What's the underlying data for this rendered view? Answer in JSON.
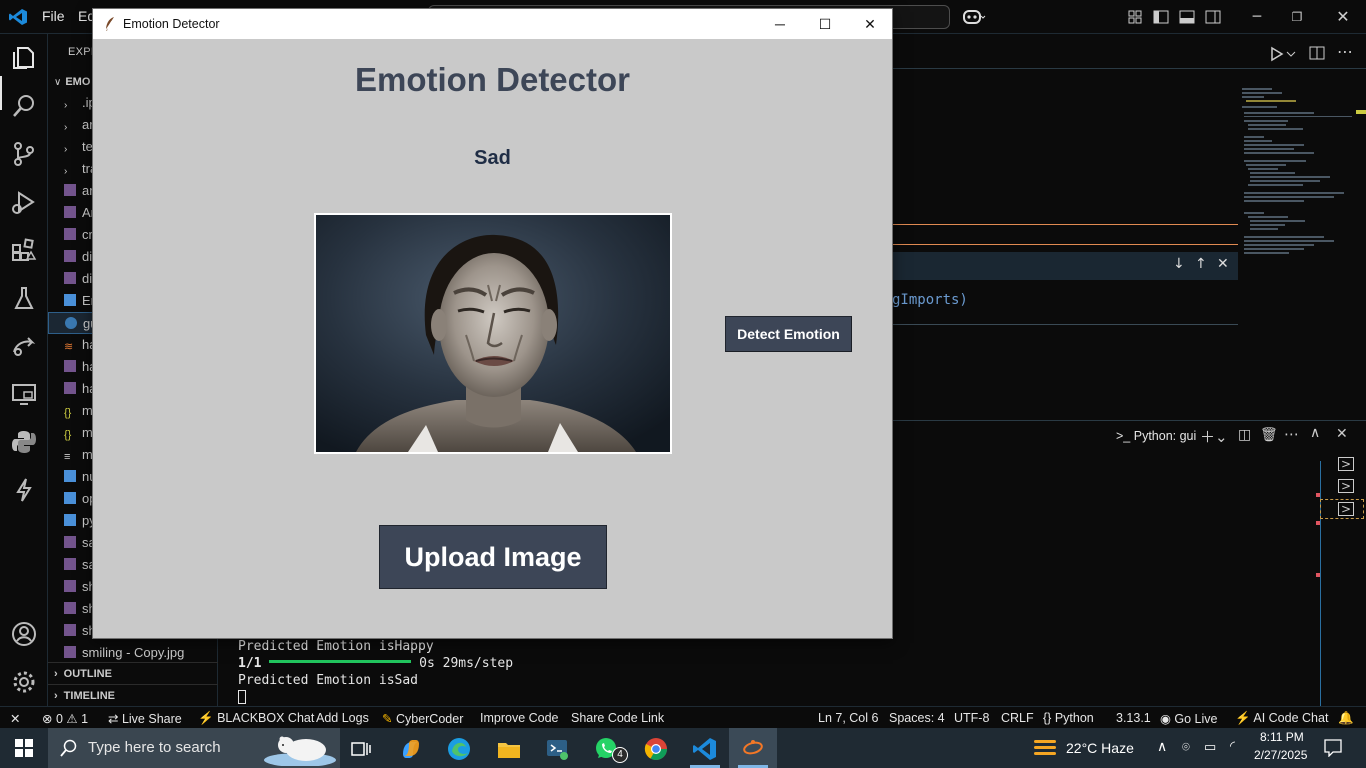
{
  "vscode": {
    "menu": [
      "File",
      "Ed"
    ],
    "explorer_header": "EXPLO",
    "folder_label": "EMO",
    "tree": [
      ".ip",
      "ar",
      "te",
      "tra",
      "ar",
      "An",
      "cr",
      "di",
      "di",
      "En",
      "gu",
      "ha",
      "ha",
      "ha",
      "m",
      "m",
      "m",
      "nu",
      "op",
      "py",
      "sa",
      "sa",
      "sh",
      "sh",
      "sh",
      "smiling - Copy.jpg"
    ],
    "outline_label": "OUTLINE",
    "timeline_label": "TIMELINE",
    "editor_snippet": "gImports)",
    "terminal_tab": "Python: gui",
    "terminal_lines": [
      "Predicted Emotion isHappy",
      "1/1 ━━━━━━━━━━━━━━━━━━━━ 0s 29ms/step",
      "Predicted Emotion isSad",
      "█"
    ],
    "progress_label": "1/1",
    "progress_text": "0s 29ms/step",
    "status": {
      "errors": "0",
      "warnings": "1",
      "live_share": "Live Share",
      "blackbox": "BLACKBOX Chat",
      "add_logs": "Add Logs",
      "cybercoder": "CyberCoder",
      "improve_code": "Improve Code",
      "share_code_link": "Share Code Link",
      "position": "Ln 7, Col 6",
      "spaces": "Spaces: 4",
      "encoding": "UTF-8",
      "eol": "CRLF",
      "language": "Python",
      "version": "3.13.1",
      "go_live": "Go Live",
      "ai_chat": "AI Code Chat"
    }
  },
  "taskbar": {
    "search_placeholder": "Type here to search",
    "weather": "22°C  Haze",
    "time": "8:11 PM",
    "date": "2/27/2025",
    "whatsapp_badge": "4"
  },
  "app": {
    "window_title": "Emotion Detector",
    "heading": "Emotion Detector",
    "result": "Sad",
    "detect_button": "Detect Emotion",
    "upload_button": "Upload Image",
    "colors": {
      "button_bg": "#3d4657",
      "window_bg": "#c9c9c9",
      "heading": "#3d4657"
    }
  }
}
